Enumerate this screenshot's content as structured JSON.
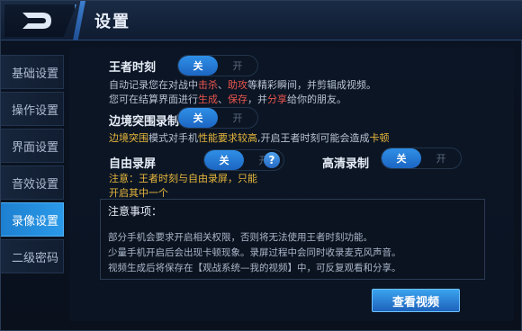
{
  "header": {
    "title": "设置"
  },
  "sidebar": {
    "items": [
      {
        "label": "基础设置"
      },
      {
        "label": "操作设置"
      },
      {
        "label": "界面设置"
      },
      {
        "label": "音效设置"
      },
      {
        "label": "录像设置",
        "active": true
      },
      {
        "label": "二级密码"
      }
    ]
  },
  "settings": {
    "king_moment": {
      "label": "王者时刻",
      "toggle": {
        "off": "关",
        "on": "开",
        "selected": "关"
      },
      "desc1": {
        "a": "自动记录您在对战中",
        "b": "击杀",
        "c": "、",
        "d": "助攻",
        "e": "等精彩瞬间，并剪辑成视频。"
      },
      "desc2": {
        "a": "您可在结算界面进行",
        "b": "生成",
        "c": "、",
        "d": "保存",
        "e": "，并",
        "f": "分享",
        "g": "给你的朋友。"
      }
    },
    "frontier": {
      "label": "边境突围录制",
      "toggle": {
        "off": "关",
        "on": "开",
        "selected": "关"
      },
      "desc": {
        "a": "边境突围",
        "b": "模式对手机",
        "c": "性能要求较高",
        "d": ",开启王者时刻可能会造成",
        "e": "卡顿"
      }
    },
    "free_record": {
      "label": "自由录屏",
      "toggle": {
        "off": "关",
        "on": "开",
        "selected": "关"
      },
      "help": "?",
      "note1": "注意：王者时刻与自由录屏，只能",
      "note2": "开启其中一个"
    },
    "hd_record": {
      "label": "高清录制",
      "toggle": {
        "off": "关",
        "on": "开",
        "selected": "关"
      }
    }
  },
  "notice": {
    "title": "注意事项：",
    "lines": [
      "部分手机会要求开启相关权限，否则将无法使用王者时刻功能。",
      "少量手机开启后会出现卡顿现象。录屏过程中会同时收录麦克风声音。",
      "视频生成后将保存在【观战系统—我的视频】中，可反复观看和分享。"
    ]
  },
  "view_button": {
    "label": "查看视频"
  },
  "colors": {
    "accent": "#2a9ae8",
    "highlight_red": "#e8554d",
    "highlight_yellow": "#e7b73c"
  }
}
